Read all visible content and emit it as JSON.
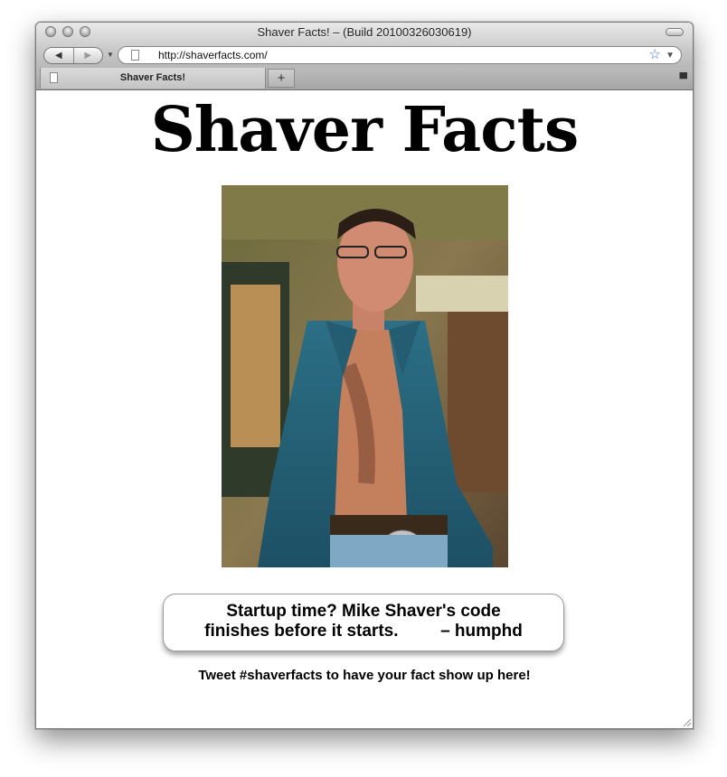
{
  "window": {
    "title": "Shaver Facts! – (Build 20100326030619)",
    "url": "http://shaverfacts.com/",
    "tab_label": "Shaver Facts!",
    "new_tab": "+",
    "back": "◀",
    "forward": "▶"
  },
  "page": {
    "heading": "Shaver Facts",
    "fact_line1": "Startup time? Mike Shaver's code",
    "fact_line2": "finishes before it starts.",
    "fact_author": "– humphd",
    "promo": "Tweet #shaverfacts to have your fact show up here!"
  },
  "icons": {
    "bookmark": "star-icon",
    "page": "page-icon"
  },
  "colors": {
    "star": "#3b74c8",
    "heading": "#000000"
  }
}
